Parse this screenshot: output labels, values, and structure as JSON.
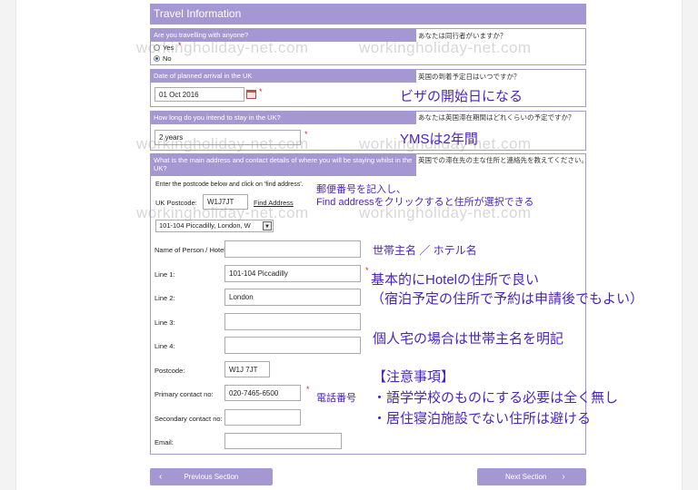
{
  "header": {
    "title": "Travel Information"
  },
  "q1": {
    "label": "Are you travelling with anyone?",
    "jp": "あなたは同行者がいますか？",
    "options": [
      "Yes",
      "No"
    ],
    "selected": "No"
  },
  "q2": {
    "label": "Date of planned arrival in the UK",
    "jp": "英国の到着予定日はいつですか？",
    "value": "01 Oct 2016"
  },
  "q3": {
    "label": "How long do you intend to stay in the UK?",
    "jp": "あなたは英国滞在期間はどれくらいの予定ですか？",
    "value": "2 years"
  },
  "q4": {
    "label": "What is the main address and contact details of where you will be staying whilst in the UK?",
    "jp": "英国での滞在先の主な住所と連絡先を教えてください。",
    "instruction": "Enter the postcode below and click on 'find address'.",
    "postcode_label": "UK Postcode:",
    "postcode_value": "W1J7JT",
    "find_link": "Find Address",
    "address_select": "101-104 Piccadilly, London, W",
    "fields": {
      "name_label": "Name of Person / Hotel",
      "name_value": "",
      "line1_label": "Line 1:",
      "line1_value": "101-104 Piccadilly",
      "line2_label": "Line 2:",
      "line2_value": "London",
      "line3_label": "Line 3:",
      "line3_value": "",
      "line4_label": "Line 4:",
      "line4_value": "",
      "postcode_label": "Postcode:",
      "postcode_value": "W1J 7JT",
      "primary_label": "Primary contact no:",
      "primary_value": "020-7465-6500",
      "secondary_label": "Secondary contact no:",
      "secondary_value": "",
      "email_label": "Email:",
      "email_value": ""
    }
  },
  "nav": {
    "prev": "Previous Section",
    "next": "Next Section"
  },
  "annotations": {
    "visa_start": "ビザの開始日になる",
    "yms": "YMSは2年間",
    "postcode_note1": "郵便番号を記入し、",
    "postcode_note2": "Find addressをクリックすると住所が選択できる",
    "household": "世帯主名 ／ ホテル名",
    "hotel_ok": "基本的にHotelの住所で良い",
    "booking": "（宿泊予定の住所で予約は申請後でもよい）",
    "private_home": "個人宅の場合は世帯主名を明記",
    "phone": "電話番号",
    "notes_title": "【注意事項】",
    "note1": "・語学学校のものにする必要は全く無し",
    "note2": "・居住寝泊施設でない住所は避ける"
  },
  "watermark": "workingholiday-net.com",
  "colors": {
    "accent": "#a598d2",
    "annotation": "#4a23c8",
    "required": "#d2252f"
  }
}
